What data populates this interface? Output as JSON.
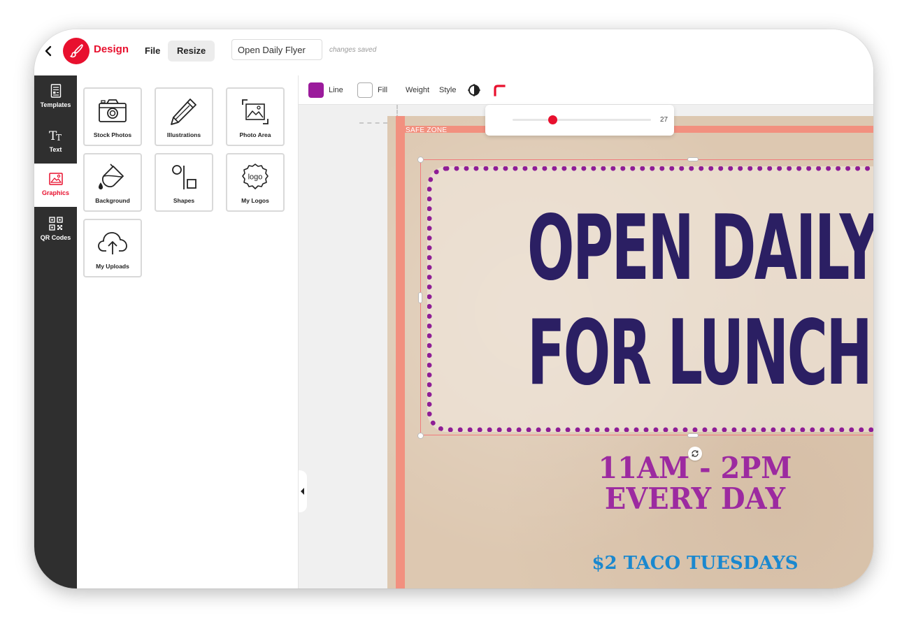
{
  "header": {
    "brand": "Design",
    "menu_file": "File",
    "menu_resize": "Resize",
    "document_name": "Open Daily Flyer",
    "save_status": "changes saved"
  },
  "sidebar": {
    "items": [
      {
        "label": "Templates",
        "icon": "templates-icon"
      },
      {
        "label": "Text",
        "icon": "text-icon"
      },
      {
        "label": "Graphics",
        "icon": "graphics-icon",
        "active": true
      },
      {
        "label": "QR Codes",
        "icon": "qr-code-icon"
      }
    ]
  },
  "graphics_panel": {
    "tiles": [
      {
        "label": "Stock Photos",
        "icon": "camera-icon"
      },
      {
        "label": "Illustrations",
        "icon": "pencil-icon"
      },
      {
        "label": "Photo Area",
        "icon": "photo-area-icon"
      },
      {
        "label": "Background",
        "icon": "paint-bucket-icon"
      },
      {
        "label": "Shapes",
        "icon": "shapes-icon"
      },
      {
        "label": "My Logos",
        "icon": "logo-badge-icon",
        "icon_text": "logo"
      },
      {
        "label": "My Uploads",
        "icon": "cloud-upload-icon"
      }
    ]
  },
  "toolbar": {
    "line_label": "Line",
    "line_color": "#9b1b9c",
    "fill_label": "Fill",
    "fill_color": "#ffffff",
    "weight_label": "Weight",
    "style_label": "Style",
    "weight_value": "27",
    "weight_fraction": 0.29
  },
  "canvas": {
    "safe_zone_label": "SAFE ZONE",
    "headline_line1": "OPEN DAILY",
    "headline_line2": "FOR LUNCH!",
    "hours_line1": "11AM - 2PM",
    "hours_line2": "EVERY DAY",
    "promo": "$2 TACO TUESDAYS"
  },
  "colors": {
    "accent": "#e8102e",
    "rail_bg": "#2f2f2f",
    "headline": "#2b1f63",
    "hours": "#9c2aa0",
    "promo": "#1a88cf",
    "safe_zone": "#f2907f",
    "flyer_bg": "#ddc8b1"
  }
}
